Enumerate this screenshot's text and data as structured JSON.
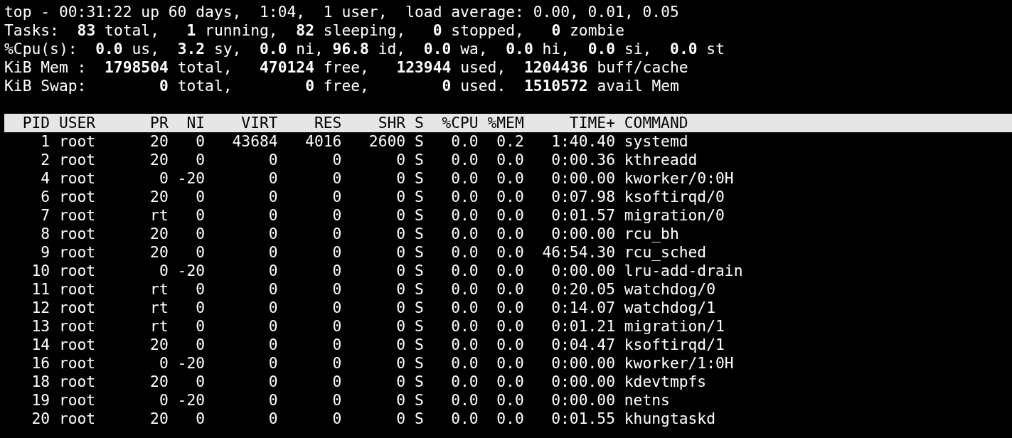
{
  "summary_lines": [
    "top - 00:31:22 up 60 days,  1:04,  1 user,  load average: 0.00, 0.01, 0.05",
    "Tasks:  **83** total,   **1** running,  **82** sleeping,   **0** stopped,   **0** zombie",
    "%Cpu(s):  **0.0** us,  **3.2** sy,  **0.0** ni, **96.8** id,  **0.0** wa,  **0.0** hi,  **0.0** si,  **0.0** st",
    "KiB Mem :  **1798504** total,   **470124** free,   **123944** used,  **1204436** buff/cache",
    "KiB Swap:        **0** total,        **0** free,        **0** used.  **1510572** avail Mem"
  ],
  "table": {
    "columns": [
      "PID",
      "USER",
      "PR",
      "NI",
      "VIRT",
      "RES",
      "SHR",
      "S",
      "%CPU",
      "%MEM",
      "TIME+",
      "COMMAND"
    ],
    "rows": [
      [
        "1",
        "root",
        "20",
        "0",
        "43684",
        "4016",
        "2600",
        "S",
        "0.0",
        "0.2",
        "1:40.40",
        "systemd"
      ],
      [
        "2",
        "root",
        "20",
        "0",
        "0",
        "0",
        "0",
        "S",
        "0.0",
        "0.0",
        "0:00.36",
        "kthreadd"
      ],
      [
        "4",
        "root",
        "0",
        "-20",
        "0",
        "0",
        "0",
        "S",
        "0.0",
        "0.0",
        "0:00.00",
        "kworker/0:0H"
      ],
      [
        "6",
        "root",
        "20",
        "0",
        "0",
        "0",
        "0",
        "S",
        "0.0",
        "0.0",
        "0:07.98",
        "ksoftirqd/0"
      ],
      [
        "7",
        "root",
        "rt",
        "0",
        "0",
        "0",
        "0",
        "S",
        "0.0",
        "0.0",
        "0:01.57",
        "migration/0"
      ],
      [
        "8",
        "root",
        "20",
        "0",
        "0",
        "0",
        "0",
        "S",
        "0.0",
        "0.0",
        "0:00.00",
        "rcu_bh"
      ],
      [
        "9",
        "root",
        "20",
        "0",
        "0",
        "0",
        "0",
        "S",
        "0.0",
        "0.0",
        "46:54.30",
        "rcu_sched"
      ],
      [
        "10",
        "root",
        "0",
        "-20",
        "0",
        "0",
        "0",
        "S",
        "0.0",
        "0.0",
        "0:00.00",
        "lru-add-drain"
      ],
      [
        "11",
        "root",
        "rt",
        "0",
        "0",
        "0",
        "0",
        "S",
        "0.0",
        "0.0",
        "0:20.05",
        "watchdog/0"
      ],
      [
        "12",
        "root",
        "rt",
        "0",
        "0",
        "0",
        "0",
        "S",
        "0.0",
        "0.0",
        "0:14.07",
        "watchdog/1"
      ],
      [
        "13",
        "root",
        "rt",
        "0",
        "0",
        "0",
        "0",
        "S",
        "0.0",
        "0.0",
        "0:01.21",
        "migration/1"
      ],
      [
        "14",
        "root",
        "20",
        "0",
        "0",
        "0",
        "0",
        "S",
        "0.0",
        "0.0",
        "0:04.47",
        "ksoftirqd/1"
      ],
      [
        "16",
        "root",
        "0",
        "-20",
        "0",
        "0",
        "0",
        "S",
        "0.0",
        "0.0",
        "0:00.00",
        "kworker/1:0H"
      ],
      [
        "18",
        "root",
        "20",
        "0",
        "0",
        "0",
        "0",
        "S",
        "0.0",
        "0.0",
        "0:00.00",
        "kdevtmpfs"
      ],
      [
        "19",
        "root",
        "0",
        "-20",
        "0",
        "0",
        "0",
        "S",
        "0.0",
        "0.0",
        "0:00.00",
        "netns"
      ],
      [
        "20",
        "root",
        "20",
        "0",
        "0",
        "0",
        "0",
        "S",
        "0.0",
        "0.0",
        "0:01.55",
        "khungtaskd"
      ]
    ]
  }
}
